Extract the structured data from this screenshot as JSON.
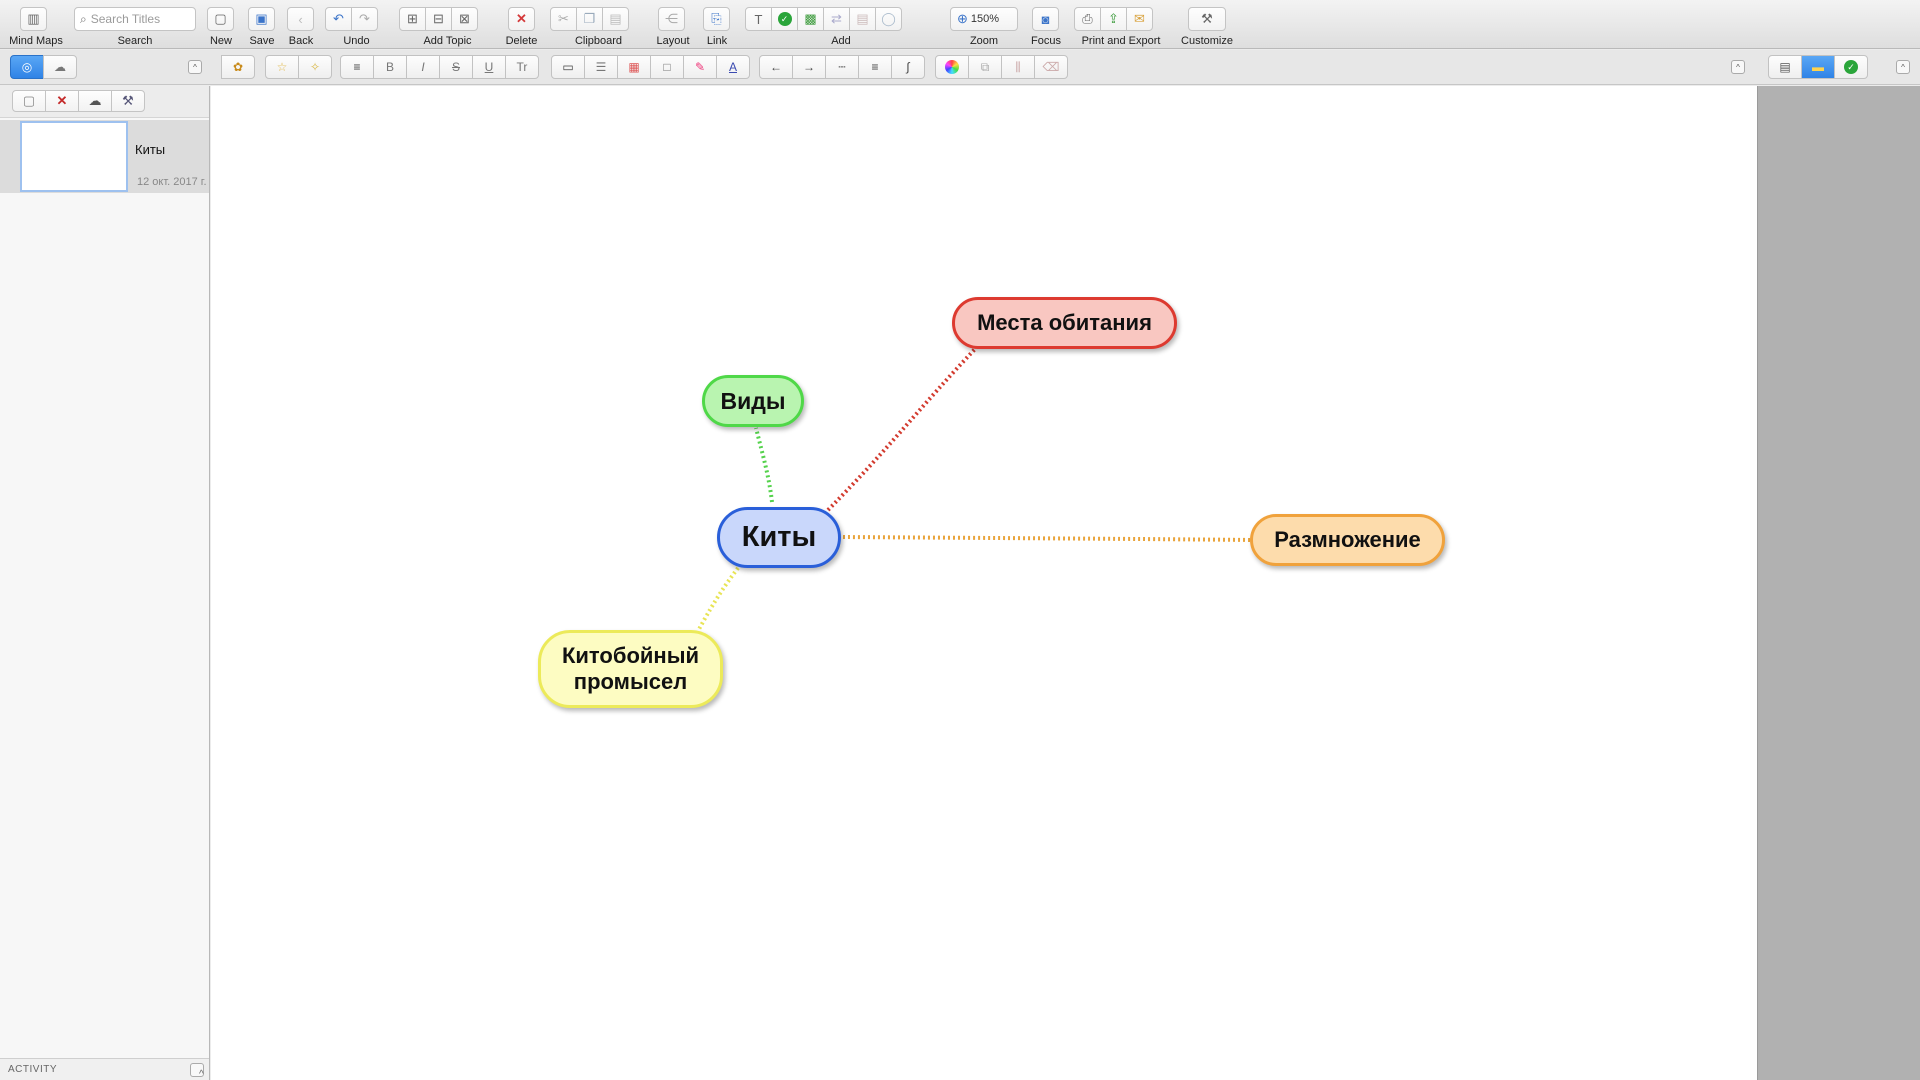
{
  "toolbar": {
    "mind_maps": "Mind Maps",
    "search_label": "Search",
    "search_placeholder": "Search Titles",
    "new": "New",
    "save": "Save",
    "back": "Back",
    "undo": "Undo",
    "add_topic": "Add Topic",
    "delete": "Delete",
    "clipboard": "Clipboard",
    "layout": "Layout",
    "link": "Link",
    "add": "Add",
    "zoom": "Zoom",
    "zoom_value": "150%",
    "focus": "Focus",
    "print_export": "Print and Export",
    "customize": "Customize"
  },
  "sidebar": {
    "maps": [
      {
        "title": "Киты",
        "date": "12 окт. 2017 г."
      }
    ],
    "activity": "ACTIVITY"
  },
  "mindmap": {
    "central": {
      "label": "Киты",
      "color": "#c9d7fb",
      "border": "#2a5fd9"
    },
    "topics": [
      {
        "label": "Места обитания",
        "color": "#f9c7c1",
        "border": "#dd3a30",
        "line": "#d23a2e"
      },
      {
        "label": "Виды",
        "color": "#b9f4b0",
        "border": "#4fd848",
        "line": "#54d24c"
      },
      {
        "label": "Размножение",
        "color": "#fddcac",
        "border": "#f0a23c",
        "line": "#e9a43b"
      },
      {
        "label": "Китобойный промысел",
        "color": "#fdfcc2",
        "border": "#ecea5a",
        "line": "#e8e455"
      }
    ]
  }
}
